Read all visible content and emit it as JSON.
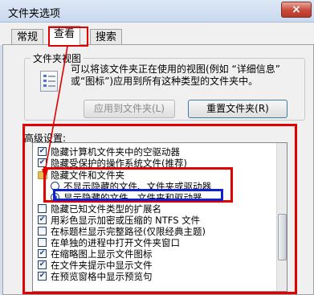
{
  "window": {
    "title": "文件夹选项",
    "close_glyph": "×"
  },
  "tabs": [
    {
      "label": "常规"
    },
    {
      "label": "查看"
    },
    {
      "label": "搜索"
    }
  ],
  "folder_view": {
    "legend": "文件夹视图",
    "description": "可以将该文件夹正在使用的视图(例如 “详细信息” 或“图标”)应用到所有这种类型的文件夹中。",
    "apply_button": "应用到文件夹(L)",
    "reset_button": "重置文件夹(R)"
  },
  "advanced": {
    "label": "高级设置:",
    "items": [
      {
        "kind": "checkbox",
        "checked": true,
        "text": "隐藏计算机文件夹中的空驱动器"
      },
      {
        "kind": "checkbox",
        "checked": true,
        "text": "隐藏受保护的操作系统文件(推荐)"
      },
      {
        "kind": "folder",
        "text": "隐藏文件和文件夹"
      },
      {
        "kind": "radio",
        "selected": false,
        "text": "不显示隐藏的文件、文件夹或驱动器"
      },
      {
        "kind": "radio",
        "selected": true,
        "text": "显示隐藏的文件、文件夹和驱动器"
      },
      {
        "kind": "checkbox",
        "checked": false,
        "text": "隐藏已知文件类型的扩展名"
      },
      {
        "kind": "checkbox",
        "checked": true,
        "text": "用彩色显示加密或压缩的 NTFS 文件"
      },
      {
        "kind": "checkbox",
        "checked": false,
        "text": "在标题栏显示完整路径(仅限经典主题)"
      },
      {
        "kind": "checkbox",
        "checked": false,
        "text": "在单独的进程中打开文件夹窗口"
      },
      {
        "kind": "checkbox",
        "checked": true,
        "text": "在缩略图上显示文件图标"
      },
      {
        "kind": "checkbox",
        "checked": true,
        "text": "在文件夹提示中显示文件"
      },
      {
        "kind": "checkbox",
        "checked": true,
        "text": "在预览窗格中显示预览句"
      }
    ]
  },
  "colors": {
    "highlight_red": "#e00000",
    "highlight_blue": "#1020d0"
  }
}
